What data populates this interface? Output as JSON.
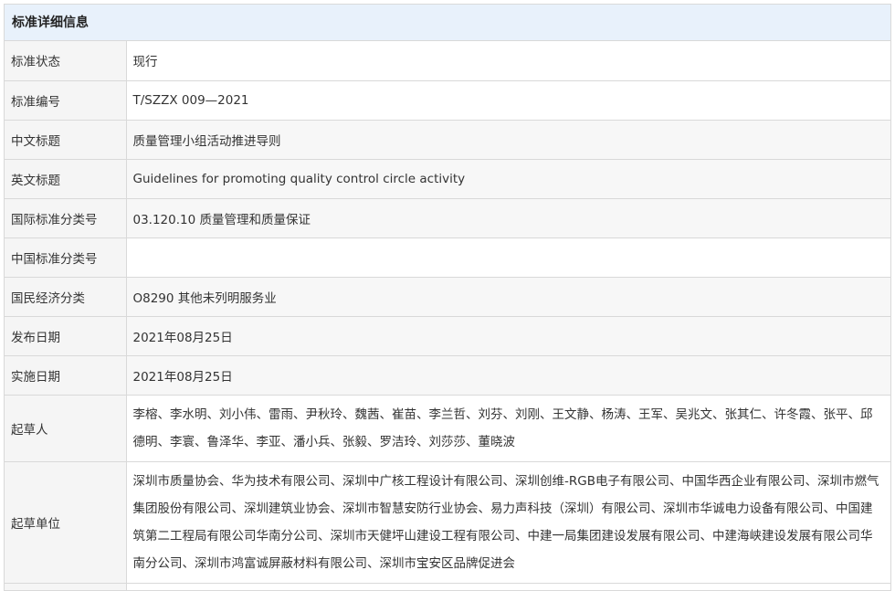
{
  "panel": {
    "title": "标准详细信息"
  },
  "rows": [
    {
      "label": "标准状态",
      "value": "现行"
    },
    {
      "label": "标准编号",
      "value": "T/SZZX 009—2021"
    },
    {
      "label": "中文标题",
      "value": "质量管理小组活动推进导则"
    },
    {
      "label": "英文标题",
      "value": "Guidelines for promoting quality control circle activity"
    },
    {
      "label": "国际标准分类号",
      "value": "03.120.10 质量管理和质量保证"
    },
    {
      "label": "中国标准分类号",
      "value": ""
    },
    {
      "label": "国民经济分类",
      "value": "O8290 其他未列明服务业"
    },
    {
      "label": "发布日期",
      "value": "2021年08月25日"
    },
    {
      "label": "实施日期",
      "value": "2021年08月25日"
    },
    {
      "label": "起草人",
      "value": "李榕、李水明、刘小伟、雷雨、尹秋玲、魏茜、崔苗、李兰哲、刘芬、刘刚、王文静、杨涛、王军、吴兆文、张其仁、许冬霞、张平、邱德明、李寰、鲁泽华、李亚、潘小兵、张毅、罗洁玲、刘莎莎、董晓波"
    },
    {
      "label": "起草单位",
      "value": "深圳市质量协会、华为技术有限公司、深圳中广核工程设计有限公司、深圳创维-RGB电子有限公司、中国华西企业有限公司、深圳市燃气集团股份有限公司、深圳建筑业协会、深圳市智慧安防行业协会、易力声科技（深圳）有限公司、深圳市华诚电力设备有限公司、中国建筑第二工程局有限公司华南分公司、深圳市天健坪山建设工程有限公司、中建一局集团建设发展有限公司、中建海峡建设发展有限公司华南分公司、深圳市鸿富诚屏蔽材料有限公司、深圳市宝安区品牌促进会"
    }
  ]
}
